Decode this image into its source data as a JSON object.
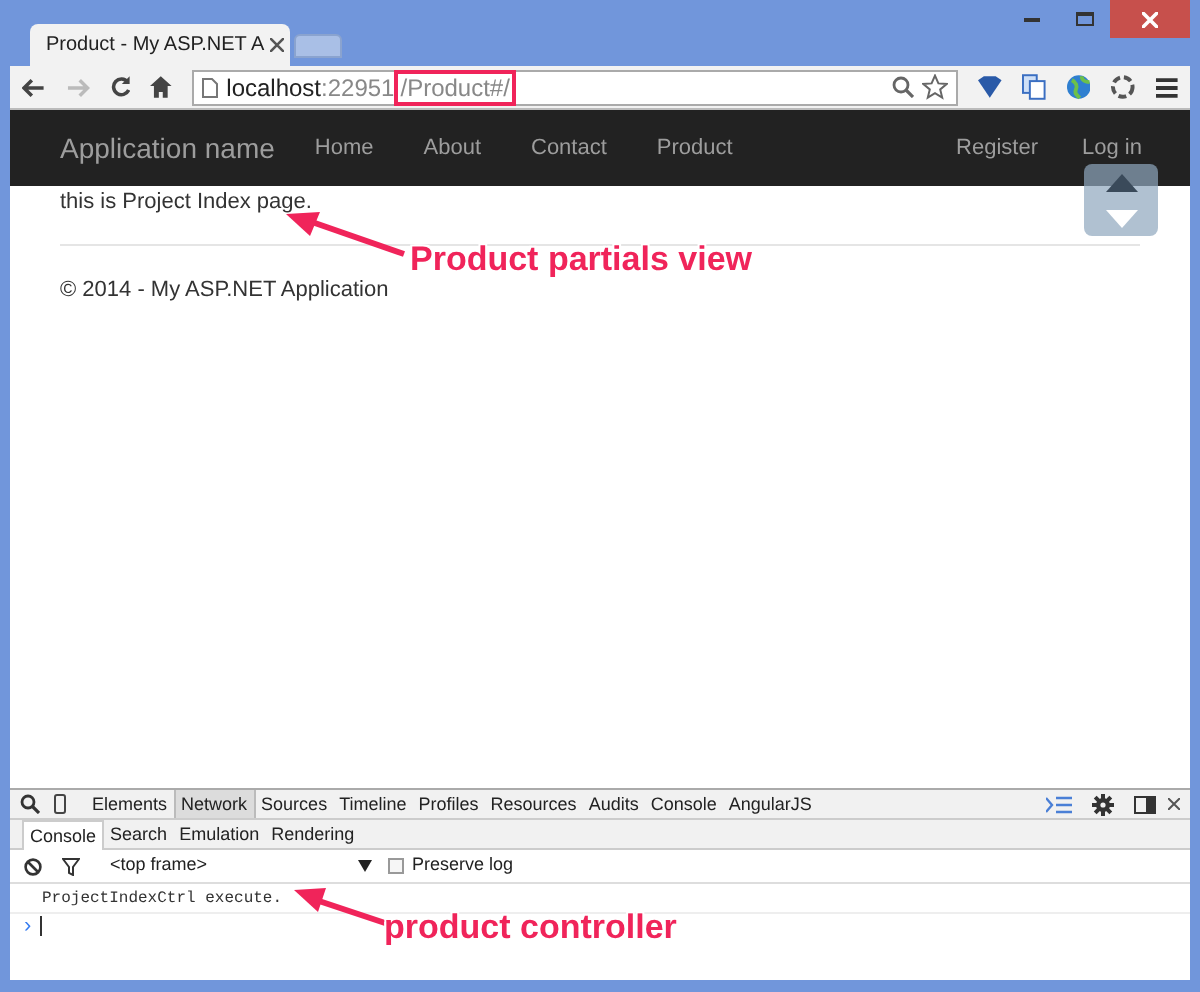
{
  "browser": {
    "tab": {
      "title": "Product - My ASP.NET A"
    },
    "address": {
      "host": "localhost",
      "port": ":22951",
      "path": "/Product#/"
    }
  },
  "navbar": {
    "brand": "Application name",
    "items": [
      "Home",
      "About",
      "Contact",
      "Product"
    ],
    "right_items": [
      "Register",
      "Log in"
    ]
  },
  "content": {
    "text": "this is Project Index page.",
    "footer": "© 2014 - My ASP.NET Application"
  },
  "devtools": {
    "tabs": [
      {
        "label": "Elements",
        "selected": false
      },
      {
        "label": "Network",
        "selected": true
      },
      {
        "label": "Sources",
        "selected": false
      },
      {
        "label": "Timeline",
        "selected": false
      },
      {
        "label": "Profiles",
        "selected": false
      },
      {
        "label": "Resources",
        "selected": false
      },
      {
        "label": "Audits",
        "selected": false
      },
      {
        "label": "Console",
        "selected": false
      },
      {
        "label": "AngularJS",
        "selected": false
      }
    ],
    "subtabs": [
      {
        "label": "Console",
        "selected": true
      },
      {
        "label": "Search",
        "selected": false
      },
      {
        "label": "Emulation",
        "selected": false
      },
      {
        "label": "Rendering",
        "selected": false
      }
    ],
    "frame": "<top frame>",
    "preserve_log": {
      "label": "Preserve log",
      "checked": false
    },
    "log": [
      "ProjectIndexCtrl execute."
    ],
    "prompt": "›"
  },
  "annotations": [
    "Product partials view",
    "product controller"
  ]
}
